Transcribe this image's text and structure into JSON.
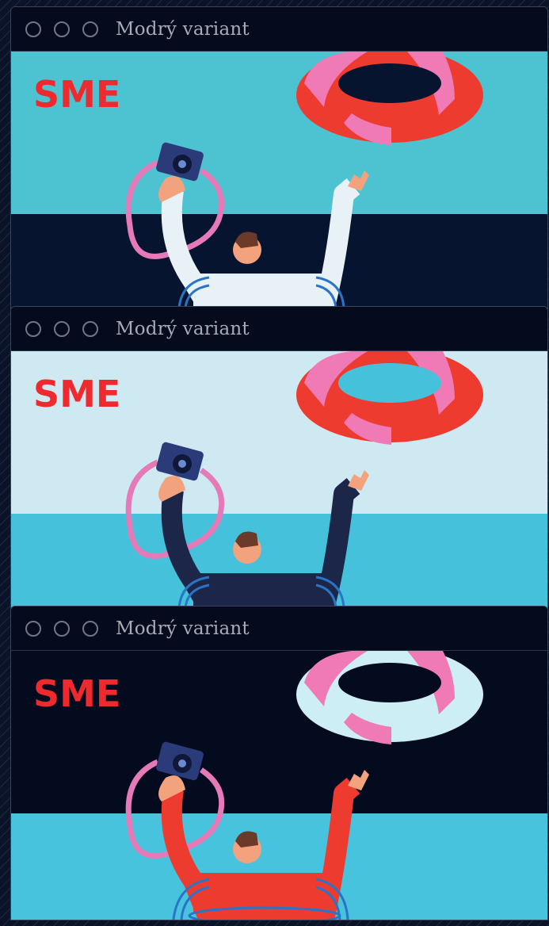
{
  "windows": [
    {
      "title": "Modrý variant",
      "logo": "SME",
      "colors": {
        "sky": "#4dc3d1",
        "water": "#071430",
        "shirt": "#e8f2f6",
        "ring_a": "#ee3b30",
        "ring_b": "#f07ab6",
        "logo": "#ee2a2e"
      }
    },
    {
      "title": "Modrý variant",
      "logo": "SME",
      "colors": {
        "sky": "#cfe9f2",
        "water": "#45c1dc",
        "shirt": "#1c2648",
        "ring_a": "#ee3b30",
        "ring_b": "#f07ab6",
        "logo": "#ee2a2e"
      }
    },
    {
      "title": "Modrý variant",
      "logo": "SME",
      "colors": {
        "sky": "#050b1f",
        "water": "#48c3dd",
        "shirt": "#ee3b30",
        "ring_a": "#cdeef4",
        "ring_b": "#f07ab6",
        "logo": "#ee2a2e"
      }
    }
  ],
  "icons": {
    "window_controls": [
      "circle-icon",
      "circle-icon",
      "circle-icon"
    ],
    "camera": "camera-icon"
  }
}
